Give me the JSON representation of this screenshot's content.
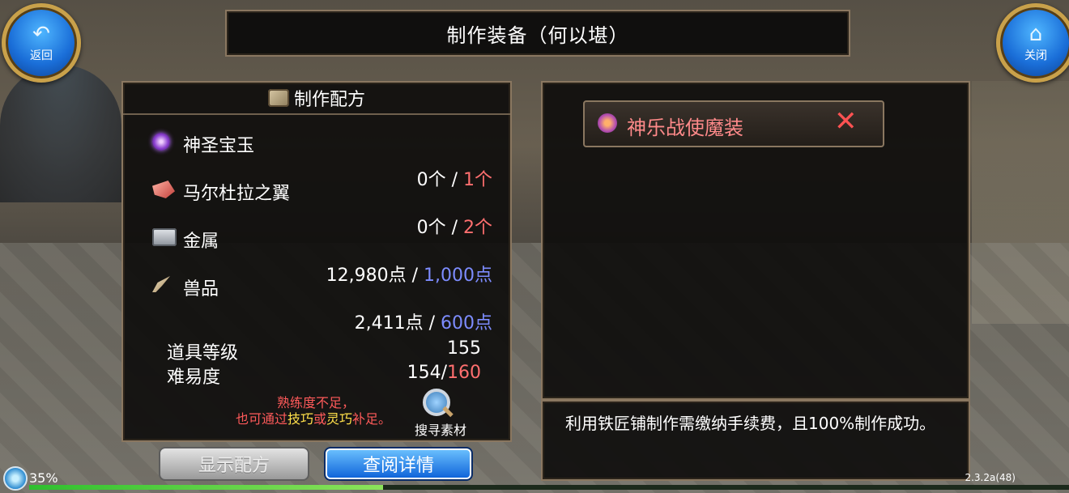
{
  "header": {
    "title": "制作装备（何以堪）",
    "back_label": "返回",
    "close_label": "关闭",
    "back_icon": "back-arrow-icon",
    "close_icon": "home-icon"
  },
  "recipe_panel": {
    "title": "制作配方",
    "materials": [
      {
        "name": "神圣宝玉",
        "have": "0个",
        "sep": " / ",
        "need": "1个",
        "need_color": "red",
        "icon": "purple-orb-icon"
      },
      {
        "name": "马尔杜拉之翼",
        "have": "0个",
        "sep": " / ",
        "need": "2个",
        "need_color": "red",
        "icon": "red-wing-icon"
      },
      {
        "name": "金属",
        "have": "12,980点",
        "sep": " / ",
        "need": "1,000点",
        "need_color": "blue",
        "icon": "metal-ingot-icon"
      },
      {
        "name": "兽品",
        "have": "2,411点",
        "sep": " / ",
        "need": "600点",
        "need_color": "blue",
        "icon": "claw-icon"
      }
    ],
    "item_level_label": "道具等级",
    "item_level_value": "155",
    "difficulty_label": "难易度",
    "difficulty_current": "154/",
    "difficulty_required": "160",
    "warning_line1": "熟练度不足，",
    "warning_line2_pre": "也可通过",
    "warning_skill": "技巧",
    "warning_or": "或",
    "warning_dex": "灵巧",
    "warning_line2_post": "补足。",
    "search_label": "搜寻素材"
  },
  "buttons": {
    "show_recipe": "显示配方",
    "view_detail": "查阅详情"
  },
  "detail_panel": {
    "item_name": "神乐战使魔装",
    "remove_glyph": "✕"
  },
  "description": {
    "text": "利用铁匠铺制作需缴纳手续费，且100%制作成功。"
  },
  "status": {
    "percent": "35%",
    "xp_fraction": 0.34,
    "version": "2.3.2a(48)"
  },
  "colors": {
    "need_red": "#ff6f6f",
    "need_blue": "#7d8cff",
    "warning_red": "#ff5a5a",
    "warning_yellow": "#ffe04a"
  }
}
